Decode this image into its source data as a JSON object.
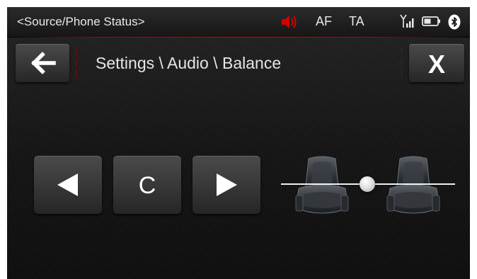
{
  "status_bar": {
    "source": "<Source/Phone Status>",
    "af": "AF",
    "ta": "TA",
    "icons": [
      "speaker-muted-icon",
      "signal-icon",
      "battery-icon",
      "bluetooth-icon"
    ],
    "mute_color": "#d40000"
  },
  "header": {
    "breadcrumb": "Settings \\ Audio \\ Balance",
    "back_icon": "arrow-left-icon",
    "close_label": "X",
    "accent_color": "#b80000"
  },
  "balance": {
    "center_label": "C",
    "left_icon": "triangle-left-icon",
    "right_icon": "triangle-right-icon",
    "slider_value": 0
  }
}
